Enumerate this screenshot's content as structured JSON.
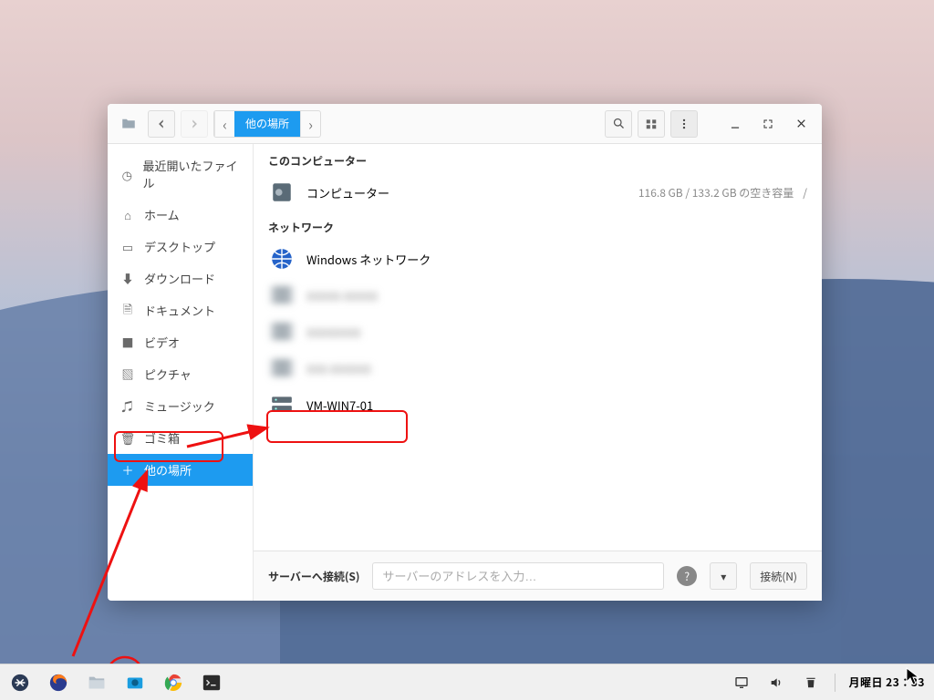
{
  "titlebar": {
    "location_active": "他の場所"
  },
  "sidebar": {
    "items": [
      {
        "label": "最近開いたファイル"
      },
      {
        "label": "ホーム"
      },
      {
        "label": "デスクトップ"
      },
      {
        "label": "ダウンロード"
      },
      {
        "label": "ドキュメント"
      },
      {
        "label": "ビデオ"
      },
      {
        "label": "ピクチャ"
      },
      {
        "label": "ミュージック"
      },
      {
        "label": "ゴミ箱"
      },
      {
        "label": "他の場所"
      }
    ]
  },
  "content": {
    "section1": "このコンピューター",
    "computer_row": {
      "label": "コンピューター",
      "detail": "116.8 GB / 133.2 GB の空き容量",
      "eject": "/"
    },
    "section2": "ネットワーク",
    "net_rows": [
      {
        "label": "Windows ネットワーク",
        "blurred": false
      },
      {
        "label": "XXXXX-XXXXX",
        "blurred": true
      },
      {
        "label": "XXXXXXXX",
        "blurred": true
      },
      {
        "label": "XXX-XXXXXX",
        "blurred": true
      },
      {
        "label": "VM-WIN7-01",
        "blurred": false,
        "highlighted": true
      }
    ]
  },
  "footer": {
    "label": "サーバーへ接続(S)",
    "placeholder": "サーバーのアドレスを入力…",
    "connect": "接続(N)"
  },
  "taskbar": {
    "clock": "月曜日 23：33"
  }
}
